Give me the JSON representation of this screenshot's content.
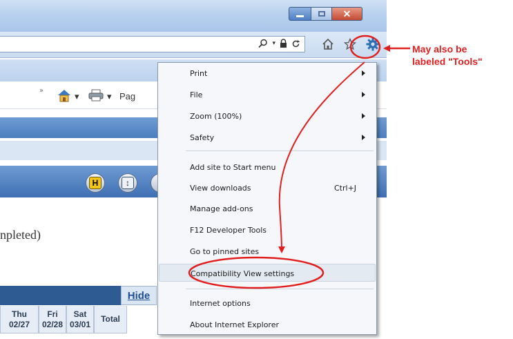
{
  "window": {
    "controls": {
      "minimize": "",
      "maximize": "",
      "close": "✕"
    }
  },
  "toolbar": {
    "overflow_chevron": "»",
    "home_dropdown": "▾",
    "print_dropdown": "▾",
    "page_label_partial": "Pag"
  },
  "page": {
    "status_text_partial": "npleted)",
    "table": {
      "hide_link": "Hide",
      "day_headers": [
        {
          "day": "Thu",
          "date": "02/27"
        },
        {
          "day": "Fri",
          "date": "02/28"
        },
        {
          "day": "Sat",
          "date": "03/01"
        },
        {
          "day": "Total",
          "date": ""
        }
      ]
    }
  },
  "tools_menu": {
    "items": [
      {
        "label": "Print",
        "submenu": true
      },
      {
        "label": "File",
        "submenu": true
      },
      {
        "label": "Zoom (100%)",
        "submenu": true
      },
      {
        "label": "Safety",
        "submenu": true
      },
      {
        "label": "Add site to Start menu"
      },
      {
        "label": "View downloads",
        "shortcut": "Ctrl+J"
      },
      {
        "label": "Manage add-ons"
      },
      {
        "label": "F12 Developer Tools"
      },
      {
        "label": "Go to pinned sites"
      },
      {
        "label": "Compatibility View settings",
        "highlighted": true
      },
      {
        "label": "Internet options"
      },
      {
        "label": "About Internet Explorer"
      }
    ]
  },
  "annotation": {
    "line1": "May also be",
    "line2": "labeled \"Tools\"",
    "color": "#e02020"
  }
}
